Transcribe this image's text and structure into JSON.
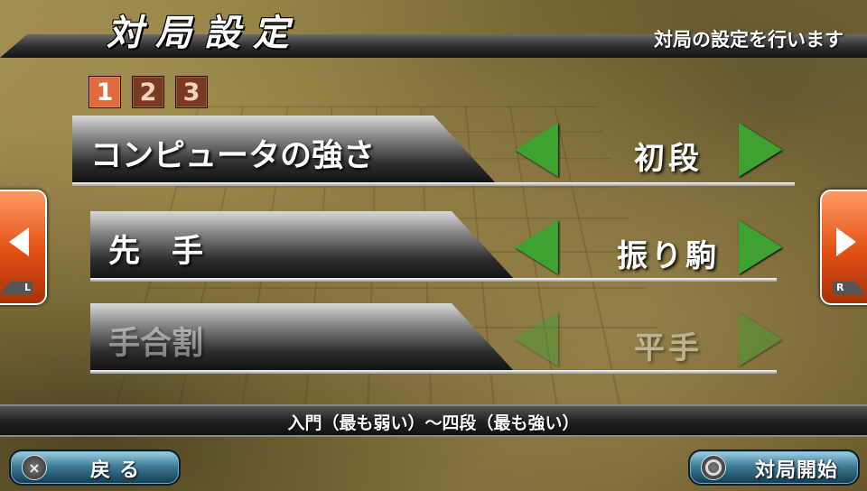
{
  "header": {
    "title": "対局設定",
    "subtitle": "対局の設定を行います"
  },
  "pages": [
    "1",
    "2",
    "3"
  ],
  "active_page": "1",
  "settings": [
    {
      "label": "コンピュータの強さ",
      "value": "初段",
      "enabled": true
    },
    {
      "label": "先　手",
      "value": "振り駒",
      "enabled": true
    },
    {
      "label": "手合割",
      "value": "平手",
      "enabled": false
    }
  ],
  "side_buttons": {
    "left_key": "L",
    "right_key": "R"
  },
  "help_text": "入門（最も弱い）～四段（最も強い）",
  "footer": {
    "back_icon": "×",
    "back_label": "戻る",
    "start_icon": "circle-icon",
    "start_label": "対局開始"
  },
  "colors": {
    "arrow": "#3da22f",
    "active_page": "#e2693c",
    "inactive_page": "#7a3a22",
    "side_button": "#e14f12"
  }
}
